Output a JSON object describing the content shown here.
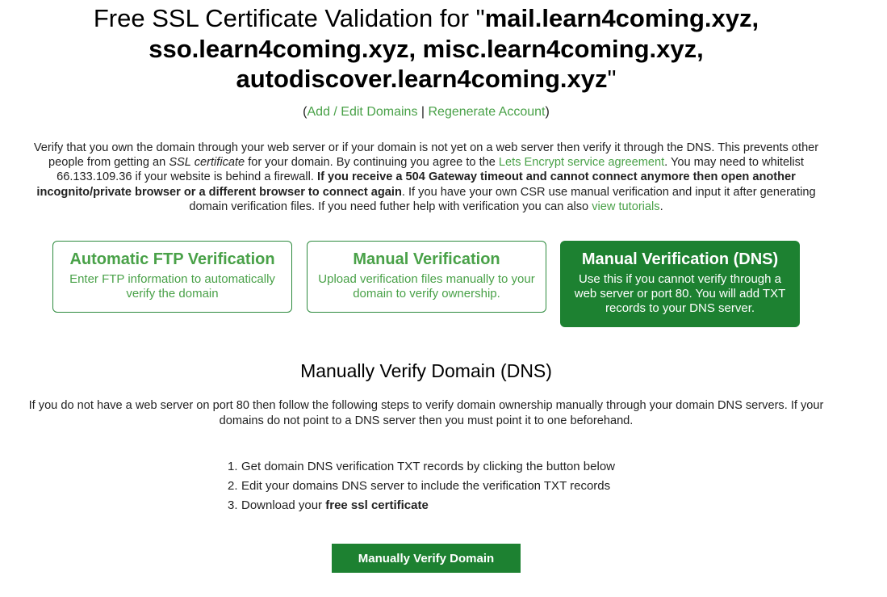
{
  "header": {
    "title_prefix": "Free SSL Certificate Validation for \"",
    "title_domains": "mail.learn4coming.xyz, sso.learn4coming.xyz, misc.learn4coming.xyz, autodiscover.learn4coming.xyz",
    "title_suffix": "\"",
    "links": {
      "open_paren": "(",
      "add_edit": "Add / Edit Domains",
      "separator": " | ",
      "regenerate": "Regenerate Account",
      "close_paren": ")"
    }
  },
  "intro": {
    "p1": "Verify that you own the domain through your web server or if your domain is not yet on a web server then verify it through the DNS. This prevents other people from getting an ",
    "italic": "SSL certificate",
    "p2": " for your domain. By continuing you agree to the ",
    "agreement_link": "Lets Encrypt service agreement",
    "p3": ". You may need to whitelist 66.133.109.36 if your website is behind a firewall. ",
    "bold": "If you receive a 504 Gateway timeout and cannot connect anymore then open another incognito/private browser or a different browser to connect again",
    "p4": ". If you have your own CSR use manual verification and input it after generating domain verification files. If you need futher help with verification you can also ",
    "tutorials_link": "view tutorials",
    "p5": "."
  },
  "methods": [
    {
      "title": "Automatic FTP Verification",
      "desc": "Enter FTP information to automatically verify the domain"
    },
    {
      "title": "Manual Verification",
      "desc": "Upload verification files manually to your domain to verify ownership."
    },
    {
      "title": "Manual Verification (DNS)",
      "desc": "Use this if you cannot verify through a web server or port 80. You will add TXT records to your DNS server."
    }
  ],
  "dns_section": {
    "title": "Manually Verify Domain (DNS)",
    "desc": "If you do not have a web server on port 80 then follow the following steps to verify domain ownership manually through your domain DNS servers. If your domains do not point to a DNS server then you must point it to one beforehand.",
    "steps": [
      {
        "num": "1.",
        "text": "Get domain DNS verification TXT records by clicking the button below",
        "bold": ""
      },
      {
        "num": "2.",
        "text": "Edit your domains DNS server to include the verification TXT records",
        "bold": ""
      },
      {
        "num": "3.",
        "text": "Download your ",
        "bold": "free ssl certificate"
      }
    ],
    "button_label": "Manually Verify Domain"
  },
  "colors": {
    "link_green": "#49a148",
    "button_green": "#1d8131"
  }
}
